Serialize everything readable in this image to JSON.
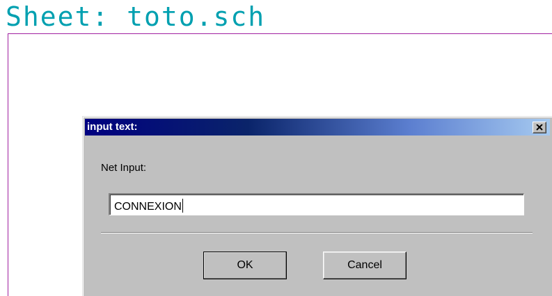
{
  "sheet": {
    "title": "Sheet: toto.sch",
    "border_color": "#a020a0",
    "title_color": "#00a0b0"
  },
  "dialog": {
    "title": "input text:",
    "close_icon": "close-icon",
    "label": "Net Input:",
    "input_value": "CONNEXION",
    "ok_label": "OK",
    "cancel_label": "Cancel"
  }
}
